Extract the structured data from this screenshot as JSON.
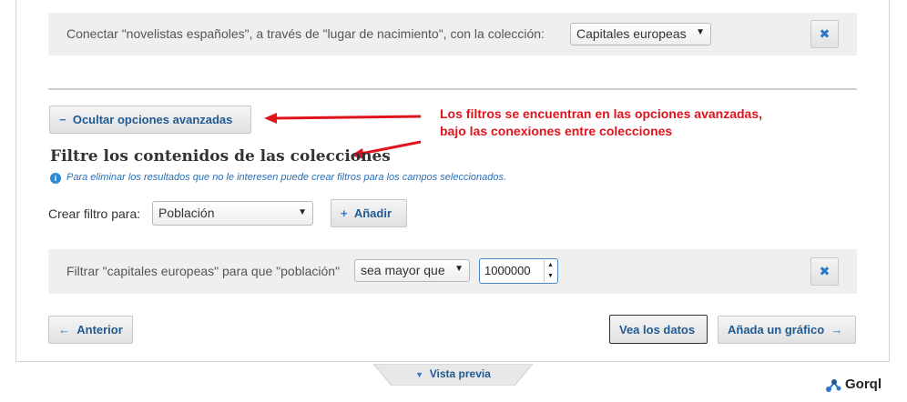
{
  "connection": {
    "text": "Conectar \"novelistas españoles\", a través de \"lugar de nacimiento\", con la colección:",
    "collection_select": "Capitales europeas",
    "remove_icon": "x-icon"
  },
  "advanced": {
    "toggle_icon": "minus-icon",
    "toggle_label": "Ocultar opciones avanzadas"
  },
  "annotation": {
    "line1": "Los filtros se encuentran en las opciones avanzadas,",
    "line2": "bajo las conexiones entre colecciones",
    "color": "#e0141d"
  },
  "filters": {
    "heading": "Filtre los contenidos de las colecciones",
    "info_icon": "i",
    "info_text": "Para eliminar los resultados que no le interesen puede crear filtros para los campos seleccionados.",
    "create_label": "Crear filtro para:",
    "field_select": "Población",
    "add_icon": "plus-icon",
    "add_label": "Añadir"
  },
  "filter_row": {
    "text": "Filtrar \"capitales europeas\" para que \"población\"",
    "operator_select": "sea mayor que",
    "value": "1000000"
  },
  "nav": {
    "back_icon": "←",
    "back_label": "Anterior",
    "view_data_label": "Vea los datos",
    "add_chart_label": "Añada un gráfico",
    "forward_icon": "→"
  },
  "preview_tab": {
    "icon": "▼",
    "label": "Vista previa"
  },
  "brand": {
    "name": "Gorql"
  },
  "colors": {
    "accent_blue": "#2a78c8",
    "button_text": "#1f5a92",
    "row_bg": "#efefef"
  }
}
